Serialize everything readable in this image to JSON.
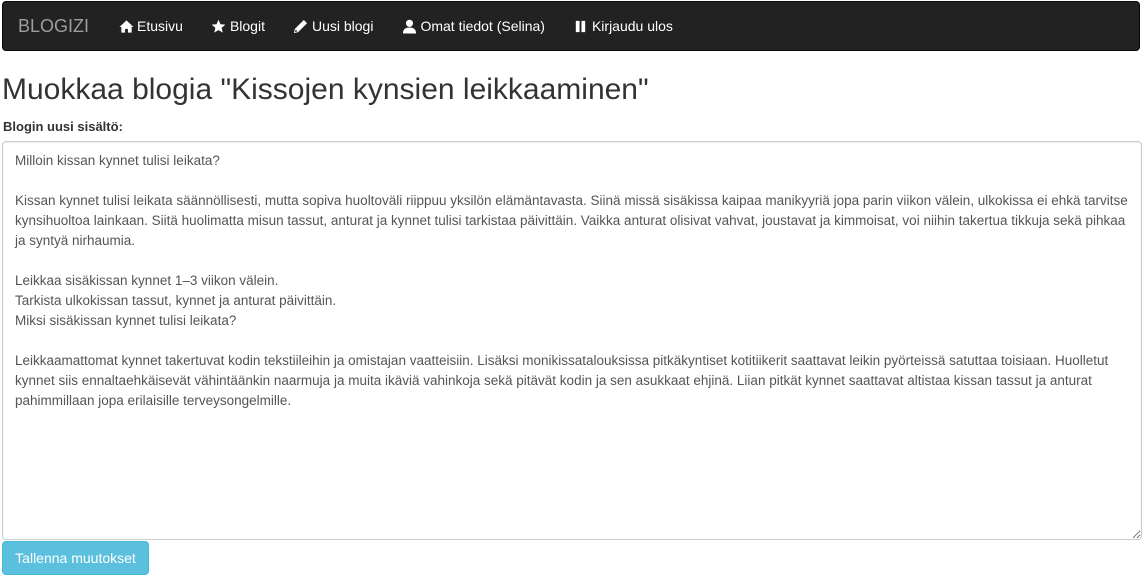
{
  "navbar": {
    "brand": "BLOGIZI",
    "items": [
      {
        "label": "Etusivu",
        "icon": "home-icon"
      },
      {
        "label": "Blogit",
        "icon": "star-icon"
      },
      {
        "label": "Uusi blogi",
        "icon": "pencil-icon"
      },
      {
        "label": "Omat tiedot (Selina)",
        "icon": "user-icon"
      },
      {
        "label": "Kirjaudu ulos",
        "icon": "pause-icon"
      }
    ],
    "colors": {
      "background": "#222222",
      "brand": "#9d9d9d",
      "link": "#ffffff"
    }
  },
  "main": {
    "title": "Muokkaa blogia \"Kissojen kynsien leikkaaminen\"",
    "content_label": "Blogin uusi sisältö:",
    "content_value": "Milloin kissan kynnet tulisi leikata?\n\nKissan kynnet tulisi leikata säännöllisesti, mutta sopiva huoltoväli riippuu yksilön elämäntavasta. Siinä missä sisäkissa kaipaa manikyyriä jopa parin viikon välein, ulkokissa ei ehkä tarvitse kynsihuoltoa lainkaan. Siitä huolimatta misun tassut, anturat ja kynnet tulisi tarkistaa päivittäin. Vaikka anturat olisivat vahvat, joustavat ja kimmoisat, voi niihin takertua tikkuja sekä pihkaa ja syntyä nirhaumia.\n\nLeikkaa sisäkissan kynnet 1–3 viikon välein.\nTarkista ulkokissan tassut, kynnet ja anturat päivittäin.\nMiksi sisäkissan kynnet tulisi leikata?\n\nLeikkaamattomat kynnet takertuvat kodin tekstiileihin ja omistajan vaatteisiin. Lisäksi monikissatalouksissa pitkäkyntiset kotitiikerit saattavat leikin pyörteissä satuttaa toisiaan. Huolletut kynnet siis ennaltaehkäisevät vähintäänkin naarmuja ja muita ikäviä vahinkoja sekä pitävät kodin ja sen asukkaat ehjinä. Liian pitkät kynnet saattavat altistaa kissan tassut ja anturat pahimmillaan jopa erilaisille terveysongelmille.",
    "save_label": "Tallenna muutokset",
    "save_color": "#5bc0de"
  }
}
